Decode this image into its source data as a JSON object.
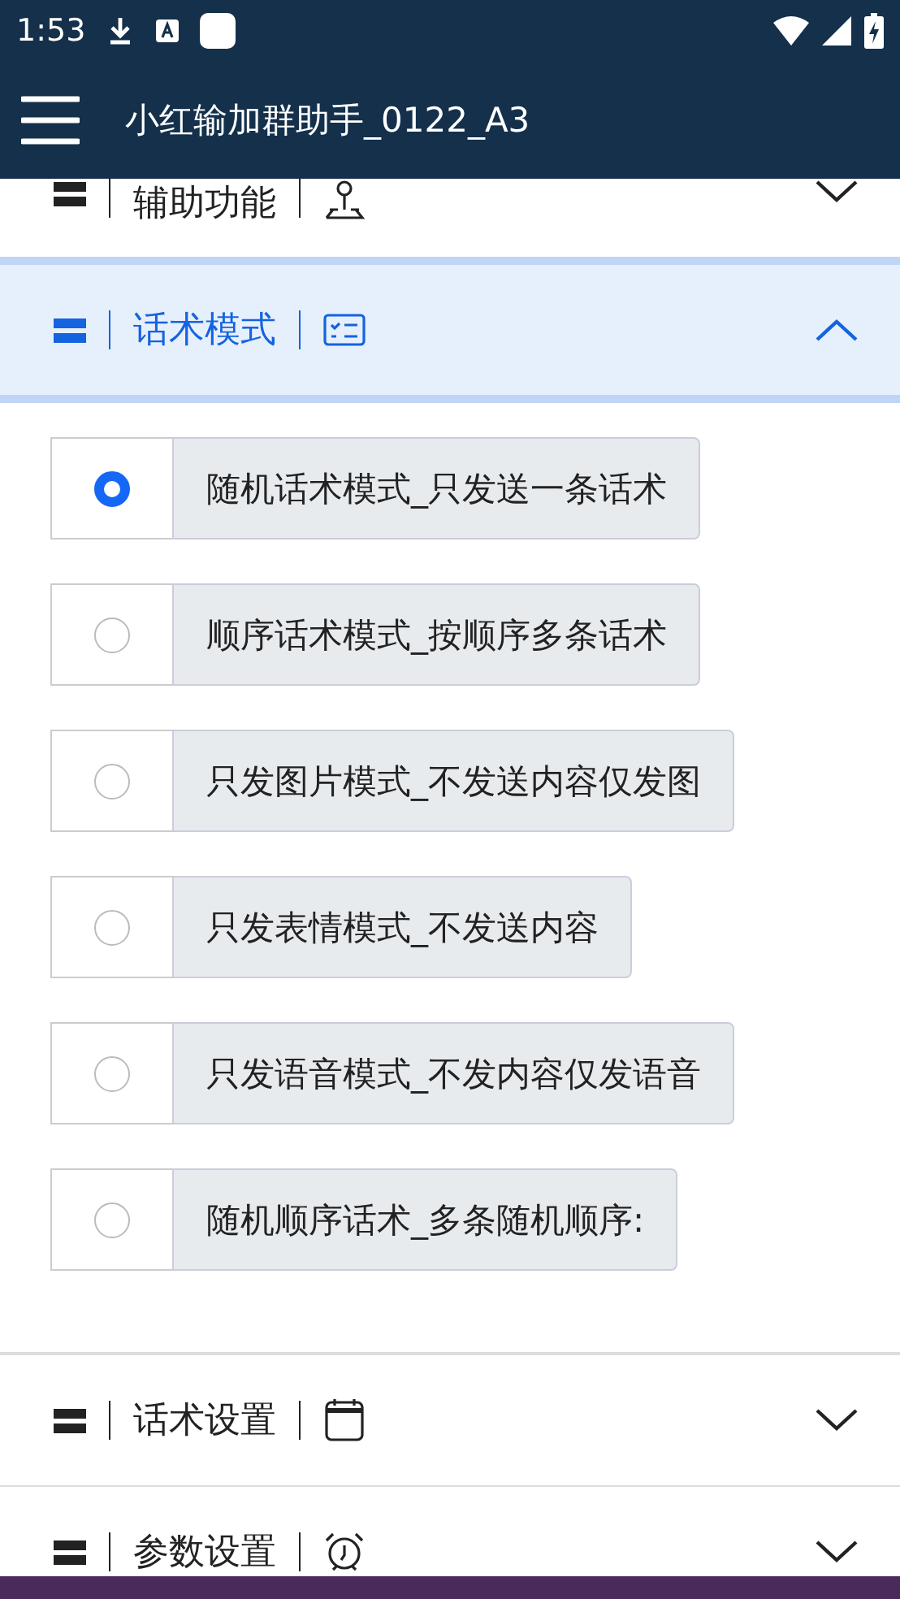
{
  "status_bar": {
    "time": "1:53"
  },
  "app_bar": {
    "title": "小红输加群助手_0122_A3"
  },
  "sections": [
    {
      "title": "辅助功能",
      "expanded": false
    },
    {
      "title": "话术模式",
      "expanded": true,
      "options": [
        {
          "label": "随机话术模式_只发送一条话术",
          "selected": true
        },
        {
          "label": "顺序话术模式_按顺序多条话术",
          "selected": false
        },
        {
          "label": "只发图片模式_不发送内容仅发图",
          "selected": false
        },
        {
          "label": "只发表情模式_不发送内容",
          "selected": false
        },
        {
          "label": "只发语音模式_不发内容仅发语音",
          "selected": false
        },
        {
          "label": "随机顺序话术_多条随机顺序:",
          "selected": false
        }
      ]
    },
    {
      "title": "话术设置",
      "expanded": false
    },
    {
      "title": "参数设置",
      "expanded": false
    }
  ]
}
